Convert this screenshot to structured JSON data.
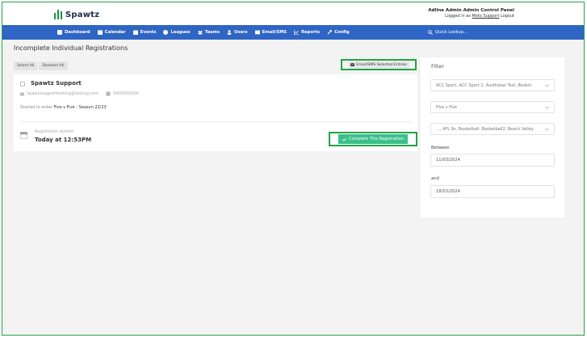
{
  "header": {
    "logo_text": "Spawtz",
    "panel_title": "Adline Admin Admin Control Panel",
    "logged_in_prefix": "Logged in as",
    "logged_in_user": "Moto Support",
    "logout_label": "Logout"
  },
  "nav": {
    "items": [
      {
        "label": "Dashboard",
        "icon": "dashboard-icon"
      },
      {
        "label": "Calendar",
        "icon": "calendar-icon"
      },
      {
        "label": "Events",
        "icon": "events-icon"
      },
      {
        "label": "Leagues",
        "icon": "leagues-icon"
      },
      {
        "label": "Teams",
        "icon": "teams-icon"
      },
      {
        "label": "Users",
        "icon": "user-icon"
      },
      {
        "label": "Email/SMS",
        "icon": "envelope-icon"
      },
      {
        "label": "Reports",
        "icon": "chart-icon"
      },
      {
        "label": "Config",
        "icon": "wrench-icon"
      }
    ],
    "quick_lookup": "Quick Lookup..."
  },
  "main": {
    "title": "Incomplete Individual Registrations",
    "select_all": "Select All",
    "deselect_all": "Deselect All",
    "email_selected": "Email/SMS Selected Entries",
    "registration": {
      "name": "Spawtz Support",
      "email": "Spawtzsupporttesting@testing.com",
      "phone": "0400000000",
      "started_prefix": "Started to enter",
      "started_event": "Five v Five - Season 22/23",
      "registration_started_label": "Registration started",
      "registration_started_time": "Today at 12:53PM",
      "complete_button": "Complete This Registration"
    }
  },
  "filter": {
    "title": "Filter",
    "venues": "ACC Sport, ACC Sport 2, Austfutsal Test, Bookin",
    "competition": "Five v Five",
    "sports": "..., AFL 9s, Basketball, Basketball2, Beach Volley",
    "between_label": "Between",
    "from_date": "11/03/2024",
    "and_label": "and",
    "to_date": "18/03/2024"
  },
  "colors": {
    "nav_bg": "#2f65c4",
    "accent_green": "#3bbf8a",
    "highlight_border": "#22a447"
  }
}
